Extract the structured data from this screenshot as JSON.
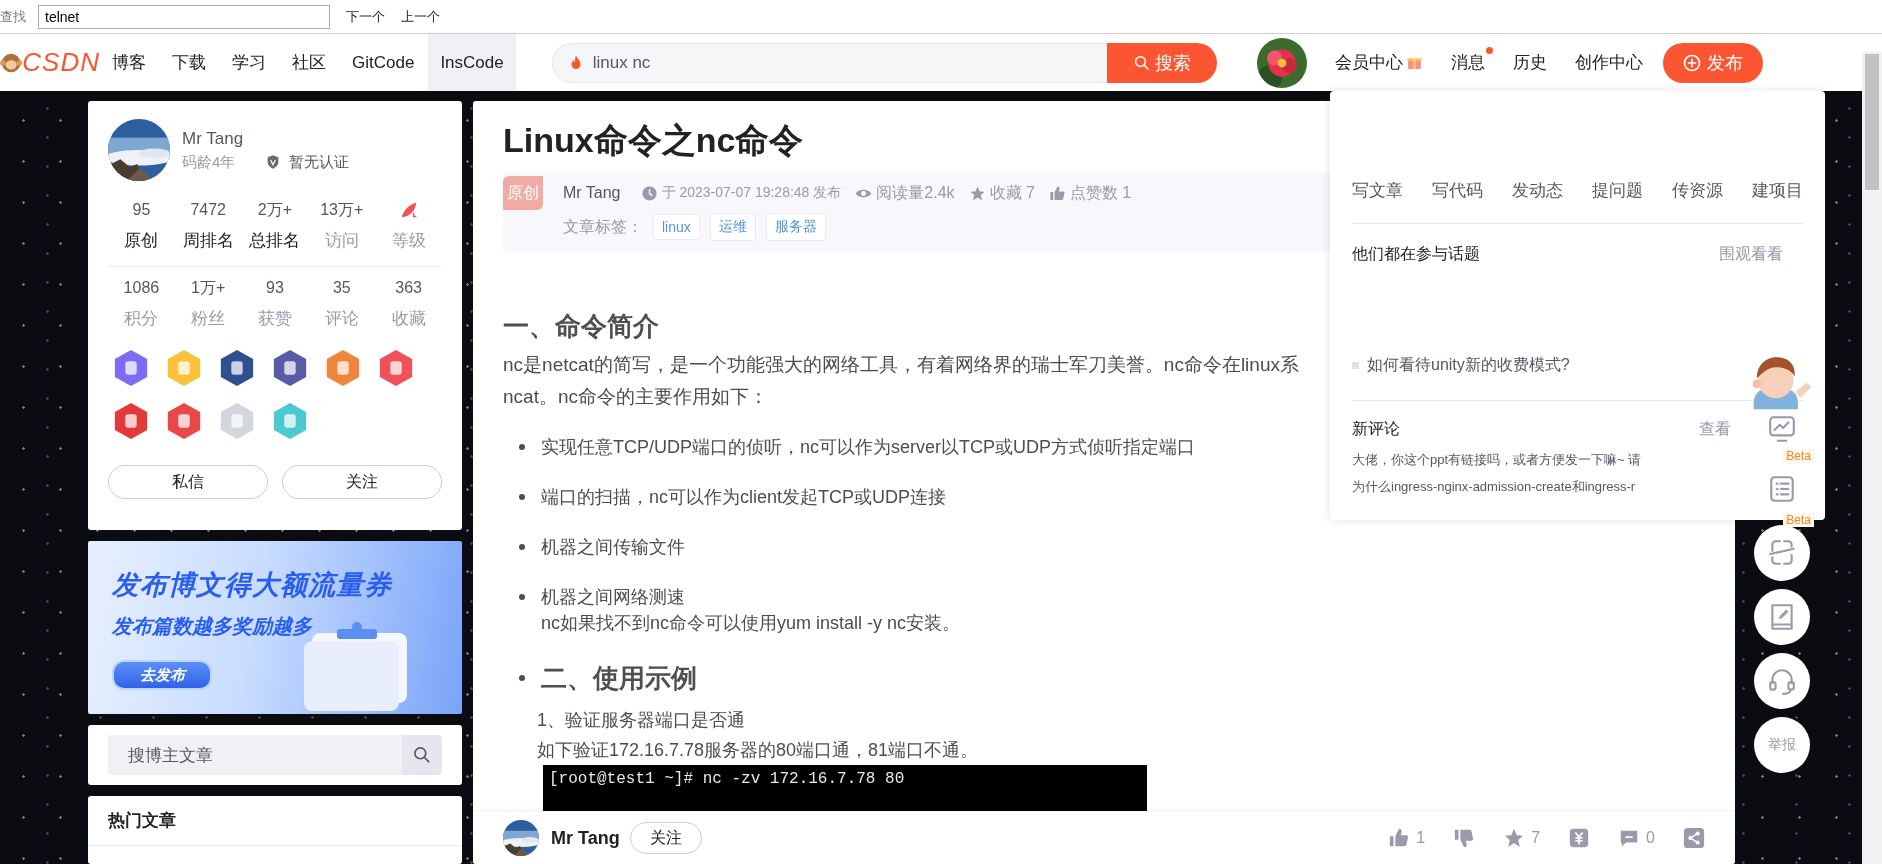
{
  "find_bar": {
    "label": "查找",
    "value": "telnet",
    "buttons": [
      "下一个",
      "上一个"
    ]
  },
  "top_nav": {
    "logo": "CSDN",
    "items": [
      {
        "label": "博客",
        "selected": false
      },
      {
        "label": "下载",
        "selected": false
      },
      {
        "label": "学习",
        "selected": false
      },
      {
        "label": "社区",
        "selected": false
      },
      {
        "label": "GitCode",
        "selected": false
      },
      {
        "label": "InsCode",
        "selected": true
      }
    ],
    "search": {
      "value": "linux nc",
      "button": "搜索"
    },
    "links": [
      {
        "label": "会员中心",
        "kind": "gift"
      },
      {
        "label": "消息",
        "kind": "dot"
      },
      {
        "label": "历史",
        "kind": "plain"
      },
      {
        "label": "创作中心",
        "kind": "plain"
      }
    ],
    "publish_button": "发布"
  },
  "profile": {
    "name": "Mr Tang",
    "age": "码龄4年",
    "cert": "暂无认证",
    "stat_rows": [
      [
        {
          "kind": "number",
          "value": "95",
          "label": "原创",
          "muted": false
        },
        {
          "kind": "number",
          "value": "7472",
          "label": "周排名",
          "muted": false
        },
        {
          "kind": "number",
          "value": "2万+",
          "label": "总排名",
          "muted": false
        },
        {
          "kind": "number",
          "value": "13万+",
          "label": "访问",
          "muted": true
        },
        {
          "kind": "level",
          "label": "等级",
          "muted": true
        }
      ],
      [
        {
          "kind": "number",
          "value": "1086",
          "label": "积分",
          "muted": true
        },
        {
          "kind": "number",
          "value": "1万+",
          "label": "粉丝",
          "muted": true
        },
        {
          "kind": "number",
          "value": "93",
          "label": "获赞",
          "muted": true
        },
        {
          "kind": "number",
          "value": "35",
          "label": "评论",
          "muted": true
        },
        {
          "kind": "number",
          "value": "363",
          "label": "收藏",
          "muted": true
        }
      ]
    ],
    "badges": [
      {
        "color": "#7c6cf2"
      },
      {
        "color": "#f8c23a"
      },
      {
        "color": "#2f4f8f"
      },
      {
        "color": "#5a5aa8"
      },
      {
        "color": "#f0843c"
      },
      {
        "color": "#f0505a"
      },
      {
        "color": "#e23a3a"
      },
      {
        "color": "#e84848"
      },
      {
        "color": "#d4d6de"
      },
      {
        "color": "#4cc8d0"
      }
    ],
    "buttons": [
      "私信",
      "关注"
    ]
  },
  "banner": {
    "title": "发布博文得大额流量券",
    "subtitle": "发布篇数越多奖励越多",
    "button": "去发布"
  },
  "blog_search": {
    "placeholder": "搜博主文章"
  },
  "hot_articles": {
    "title": "热门文章"
  },
  "article": {
    "title": "Linux命令之nc命令",
    "tag": "原创",
    "author": "Mr Tang",
    "published": "于 2023-07-07 19:28:48 发布",
    "reads": "阅读量2.4k",
    "favorites": "收藏 7",
    "likes": "点赞数 1",
    "tags_label": "文章标签：",
    "tags": [
      "linux",
      "运维",
      "服务器"
    ],
    "body": [
      {
        "kind": "h2",
        "text": "一、命令简介"
      },
      {
        "kind": "p",
        "lines": [
          "nc是netcat的简写，是一个功能强大的网络工具，有着网络界的瑞士军刀美誉。nc命令在linux系",
          "ncat。nc命令的主要作用如下："
        ]
      },
      {
        "kind": "bullets",
        "items": [
          {
            "lines": [
              "实现任意TCP/UDP端口的侦听，nc可以作为server以TCP或UDP方式侦听指定端口"
            ]
          },
          {
            "lines": [
              "端口的扫描，nc可以作为client发起TCP或UDP连接"
            ]
          },
          {
            "lines": [
              "机器之间传输文件"
            ]
          },
          {
            "lines": [
              "机器之间网络测速",
              "nc如果找不到nc命令可以使用yum install -y nc安装。"
            ]
          }
        ]
      },
      {
        "kind": "bullet_h2",
        "text": "二、使用示例"
      },
      {
        "kind": "indent_p",
        "lines": [
          "1、验证服务器端口是否通",
          "如下验证172.16.7.78服务器的80端口通，81端口不通。"
        ]
      },
      {
        "kind": "terminal",
        "lines": [
          "[root@test1 ~]# nc -zv 172.16.7.78 80"
        ]
      }
    ]
  },
  "bottom_bar": {
    "author": "Mr Tang",
    "follow": "关注",
    "actions": [
      {
        "kind": "like",
        "count": "1"
      },
      {
        "kind": "dislike"
      },
      {
        "kind": "star",
        "count": "7"
      },
      {
        "kind": "reward"
      },
      {
        "kind": "comment",
        "count": "0"
      },
      {
        "kind": "share"
      }
    ]
  },
  "create_menu": {
    "actions": [
      "写文章",
      "写代码",
      "发动态",
      "提问题",
      "传资源",
      "建项目"
    ],
    "topics_title": "他们都在参与话题",
    "topics_link": "围观看看",
    "topics": [
      "如何看待unity新的收费模式?"
    ],
    "comments_title": "新评论",
    "comments_link": "查看",
    "comments": [
      "大佬，你这个ppt有链接吗，或者方便发一下嘛~ 请",
      "为什么ingress-nginx-admission-create和ingress-r"
    ]
  },
  "side_tools": [
    {
      "kind": "chart"
    },
    {
      "kind": "list",
      "badge": "Beta"
    },
    {
      "kind": "scan",
      "badge": "Beta"
    },
    {
      "kind": "edit"
    },
    {
      "kind": "support"
    },
    {
      "kind": "text",
      "label": "举报"
    }
  ]
}
